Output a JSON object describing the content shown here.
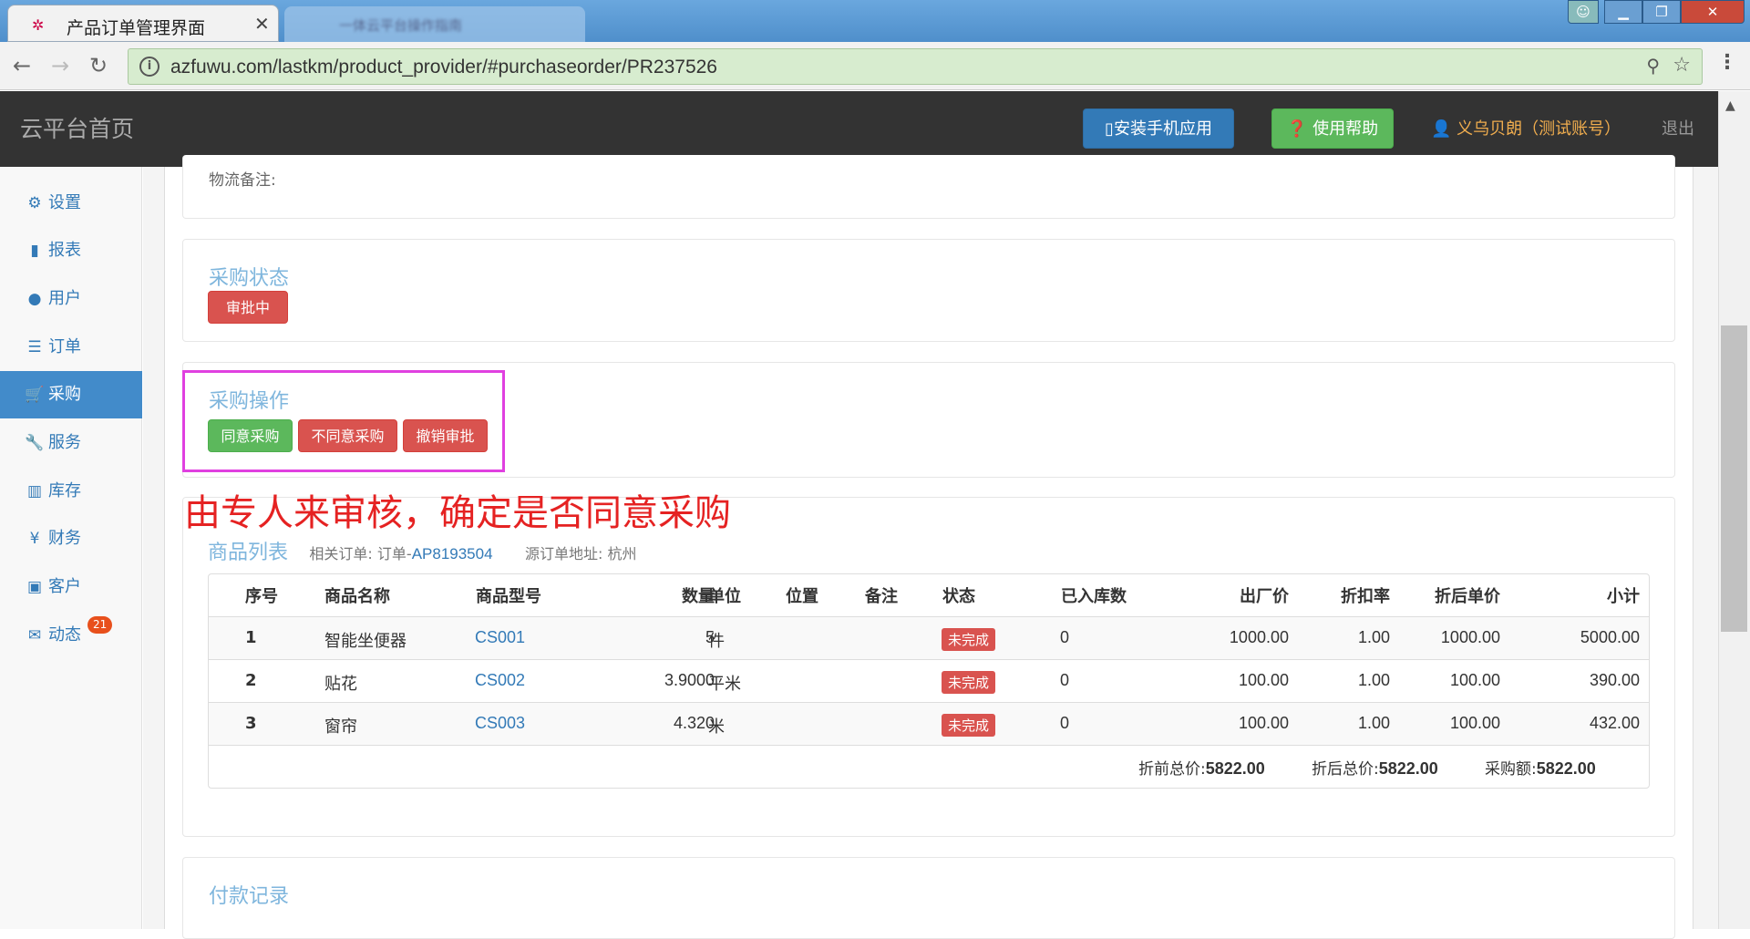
{
  "browser": {
    "tab_title": "产品订单管理界面",
    "tab2_title": "一体云平台操作指南",
    "url": "azfuwu.com/lastkm/product_provider/#purchaseorder/PR237526"
  },
  "header": {
    "brand": "云平台首页",
    "install_label": "安装手机应用",
    "help_label": "使用帮助",
    "user": "义乌贝朗（测试账号）",
    "logout": "退出"
  },
  "sidebar": {
    "items": [
      {
        "label": "设置",
        "icon": "gear-icon"
      },
      {
        "label": "报表",
        "icon": "bar-chart-icon"
      },
      {
        "label": "用户",
        "icon": "user-icon"
      },
      {
        "label": "订单",
        "icon": "list-icon"
      },
      {
        "label": "采购",
        "icon": "cart-icon",
        "active": true
      },
      {
        "label": "服务",
        "icon": "wrench-icon"
      },
      {
        "label": "库存",
        "icon": "barcode-icon"
      },
      {
        "label": "财务",
        "icon": "yen-icon"
      },
      {
        "label": "客户",
        "icon": "briefcase-icon"
      },
      {
        "label": "动态",
        "icon": "comment-icon",
        "badge": "21"
      }
    ]
  },
  "logistics": {
    "note_label": "物流备注:"
  },
  "status": {
    "title": "采购状态",
    "badge": "审批中"
  },
  "ops": {
    "title": "采购操作",
    "approve": "同意采购",
    "reject": "不同意采购",
    "revoke": "撤销审批"
  },
  "annotation": "由专人来审核，确定是否同意采购",
  "goods": {
    "title": "商品列表",
    "related_label": "相关订单: 订单-",
    "related_order": "AP8193504",
    "source_label": "源订单地址: 杭州",
    "columns": [
      "序号",
      "商品名称",
      "商品型号",
      "数量",
      "单位",
      "位置",
      "备注",
      "状态",
      "已入库数",
      "出厂价",
      "折扣率",
      "折后单价",
      "小计"
    ],
    "rows": [
      {
        "no": "1",
        "name": "智能坐便器",
        "model": "CS001",
        "qty": "5",
        "unit": "件",
        "status": "未完成",
        "stocked": "0",
        "price": "1000.00",
        "discount": "1.00",
        "net": "1000.00",
        "subtotal": "5000.00"
      },
      {
        "no": "2",
        "name": "贴花",
        "model": "CS002",
        "qty": "3.9000",
        "unit": "平米",
        "status": "未完成",
        "stocked": "0",
        "price": "100.00",
        "discount": "1.00",
        "net": "100.00",
        "subtotal": "390.00"
      },
      {
        "no": "3",
        "name": "窗帘",
        "model": "CS003",
        "qty": "4.320",
        "unit": "米",
        "status": "未完成",
        "stocked": "0",
        "price": "100.00",
        "discount": "1.00",
        "net": "100.00",
        "subtotal": "432.00"
      }
    ],
    "totals": {
      "before_label": "折前总价:",
      "before": "5822.00",
      "after_label": "折后总价:",
      "after": "5822.00",
      "purchase_label": "采购额:",
      "purchase": "5822.00"
    }
  },
  "payments": {
    "title": "付款记录"
  },
  "colors": {
    "primary": "#337ab7",
    "success": "#5cb85c",
    "danger": "#d9534f",
    "highlight": "#e040e0",
    "annotation": "#e52222"
  }
}
